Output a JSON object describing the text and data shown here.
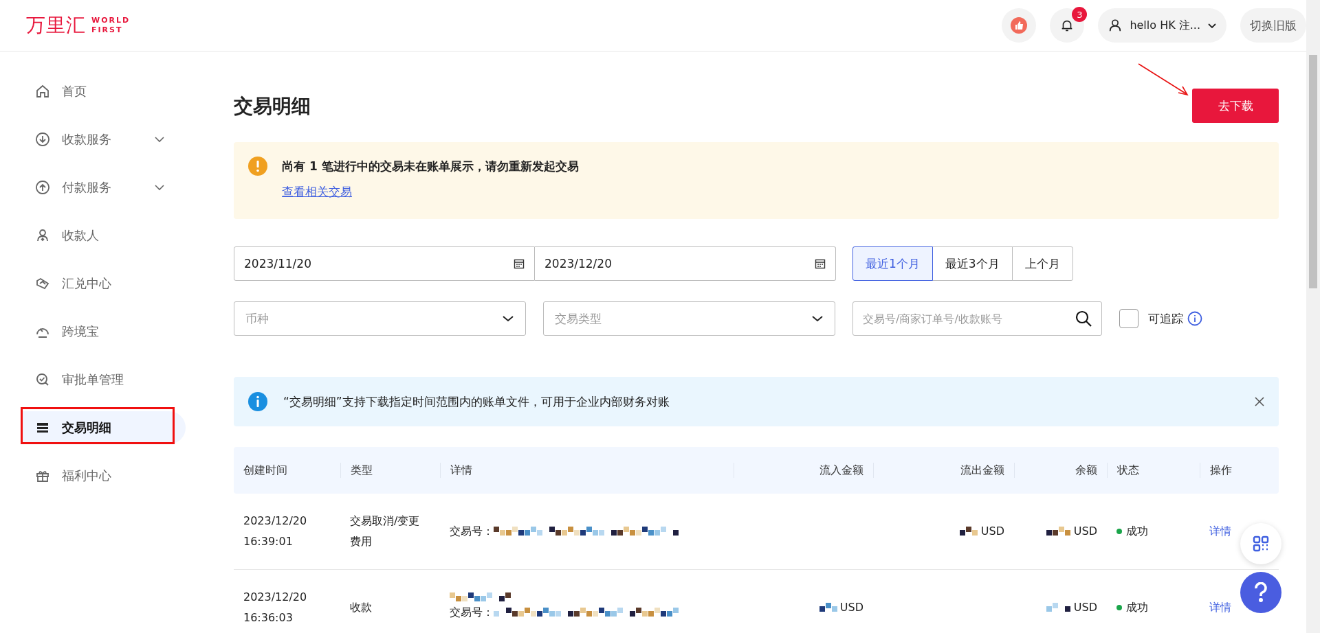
{
  "header": {
    "logo_cn": "万里汇",
    "logo_en_1": "WORLD",
    "logo_en_2": "FIRST",
    "notification_count": "3",
    "user": "hello HK 注...",
    "switch_button": "切换旧版"
  },
  "sidebar": {
    "items": [
      {
        "label": "首页",
        "kind": "home",
        "expandable": false,
        "selected": false
      },
      {
        "label": "收款服务",
        "kind": "receive",
        "expandable": true,
        "selected": false
      },
      {
        "label": "付款服务",
        "kind": "pay",
        "expandable": true,
        "selected": false
      },
      {
        "label": "收款人",
        "kind": "payee",
        "expandable": false,
        "selected": false
      },
      {
        "label": "汇兑中心",
        "kind": "exchange",
        "expandable": false,
        "selected": false
      },
      {
        "label": "跨境宝",
        "kind": "gauge",
        "expandable": false,
        "selected": false
      },
      {
        "label": "审批单管理",
        "kind": "approval",
        "expandable": false,
        "selected": false
      },
      {
        "label": "交易明细",
        "kind": "list",
        "expandable": false,
        "selected": true
      },
      {
        "label": "福利中心",
        "kind": "gift",
        "expandable": false,
        "selected": false
      }
    ]
  },
  "page": {
    "title": "交易明细",
    "download_button": "去下载"
  },
  "warning": {
    "message": "尚有 1 笔进行中的交易未在账单展示，请勿重新发起交易",
    "link": "查看相关交易"
  },
  "filters": {
    "start_date": "2023/11/20",
    "end_date": "2023/12/20",
    "ranges": [
      {
        "label": "最近1个月",
        "selected": true
      },
      {
        "label": "最近3个月",
        "selected": false
      },
      {
        "label": "上个月",
        "selected": false
      }
    ],
    "currency_placeholder": "币种",
    "type_placeholder": "交易类型",
    "search_placeholder": "交易号/商家订单号/收款账号",
    "traceable": {
      "label": "可追踪",
      "checked": false
    }
  },
  "info": {
    "message": "“交易明细”支持下载指定时间范围内的账单文件，可用于企业内部财务对账"
  },
  "table": {
    "columns": [
      "创建时间",
      "类型",
      "详情",
      "流入金额",
      "流出金额",
      "余额",
      "状态",
      "操作"
    ],
    "rows": [
      {
        "date": "2023/12/20",
        "time": "16:39:01",
        "type": "交易取消/变更费用",
        "detail_label": "交易号：",
        "outflow": "USD",
        "balance": "USD",
        "status": "成功",
        "action": "详情"
      },
      {
        "date": "2023/12/20",
        "time": "16:36:03",
        "type": "收款",
        "detail_label": "交易号：",
        "inflow": "USD",
        "balance": "USD",
        "status": "成功",
        "action": "详情"
      }
    ]
  }
}
